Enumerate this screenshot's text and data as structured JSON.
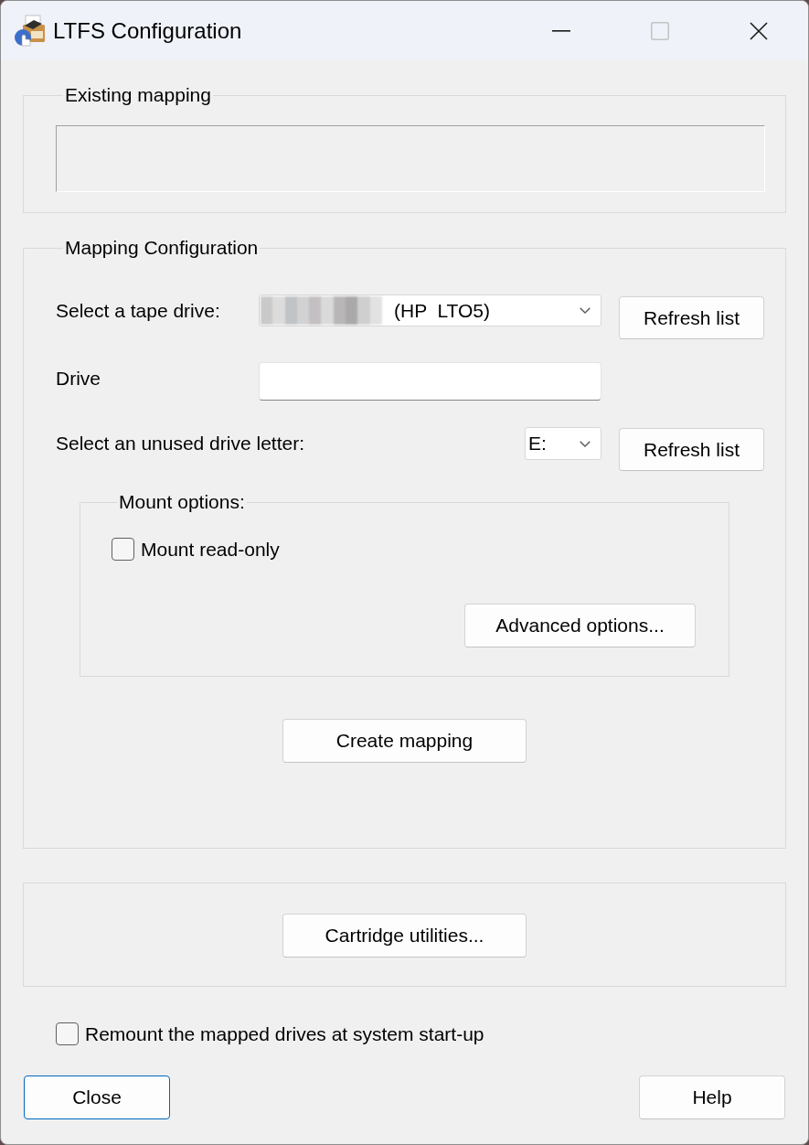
{
  "window": {
    "title": "LTFS Configuration",
    "controls": [
      {
        "kind": "minimize",
        "disabled": false
      },
      {
        "kind": "maximize",
        "disabled": true
      },
      {
        "kind": "close",
        "disabled": false
      }
    ]
  },
  "existing_mapping": {
    "label": "Existing mapping"
  },
  "mapping_configuration": {
    "label": "Mapping Configuration",
    "tape_drive": {
      "label": "Select a tape drive:",
      "redacted": true,
      "value": "(HP  LTO5)",
      "refresh_button": "Refresh list"
    },
    "drive": {
      "label": "Drive"
    },
    "drive_letter": {
      "label": "Select an unused drive letter:",
      "value": "E:",
      "refresh_button": "Refresh list"
    },
    "mount_options": {
      "label": "Mount options:",
      "read_only": {
        "label": "Mount read-only",
        "checked": false
      },
      "advanced_button": "Advanced options..."
    },
    "create_button": "Create mapping"
  },
  "cartridge_button": "Cartridge utilities...",
  "remount": {
    "label": "Remount the mapped drives at system start-up",
    "checked": false
  },
  "buttons": [
    {
      "label": "Close",
      "focused": true
    },
    {
      "label": "Help",
      "focused": false
    }
  ]
}
